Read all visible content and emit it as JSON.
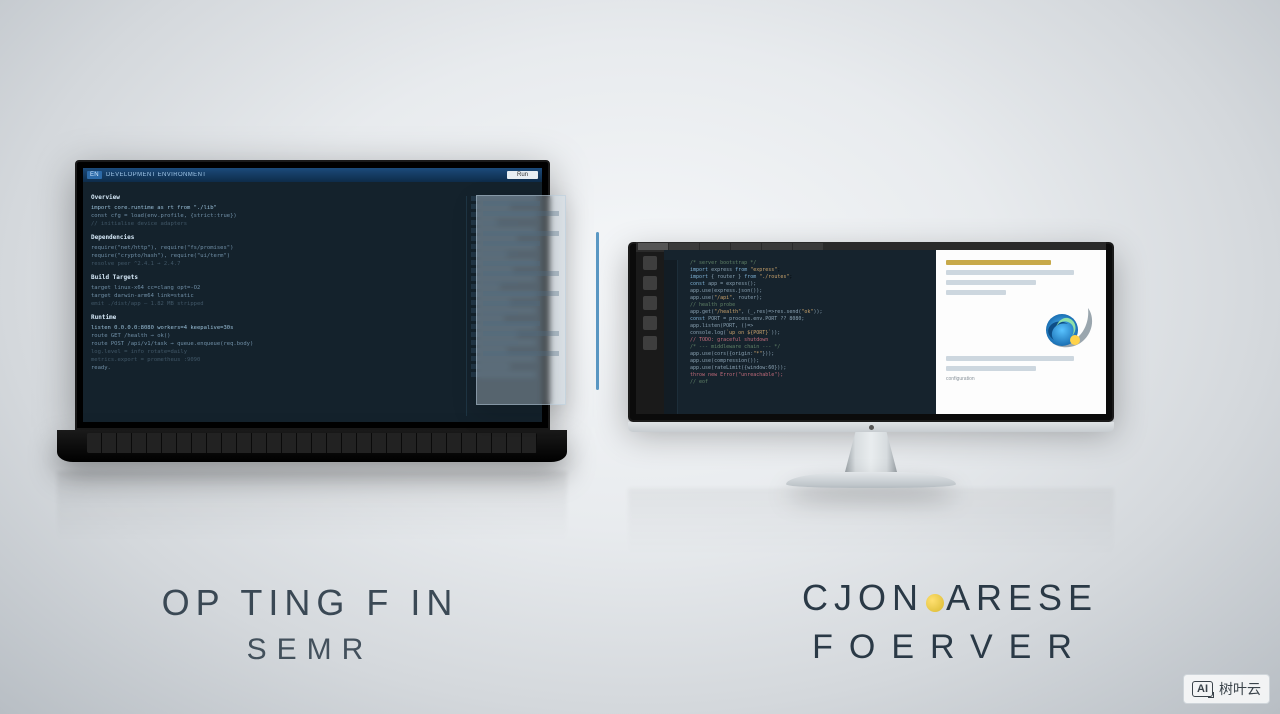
{
  "laptop": {
    "titlebar": {
      "badge": "EN",
      "title": "DEVELOPMENT ENVIRONMENT",
      "right_button": "Run"
    },
    "sections": [
      "Overview",
      "Dependencies",
      "Build Targets",
      "Runtime"
    ]
  },
  "monitor": {
    "right_panel_note": "configuration"
  },
  "captions": {
    "left_line1": "OP TING F IN",
    "left_line2": "SEMR",
    "right_line1_prefix": "CJON",
    "right_line1_suffix": "ARESE",
    "right_line2": "FOERVER"
  },
  "watermark": {
    "badge": "AI",
    "text": "树叶云"
  }
}
